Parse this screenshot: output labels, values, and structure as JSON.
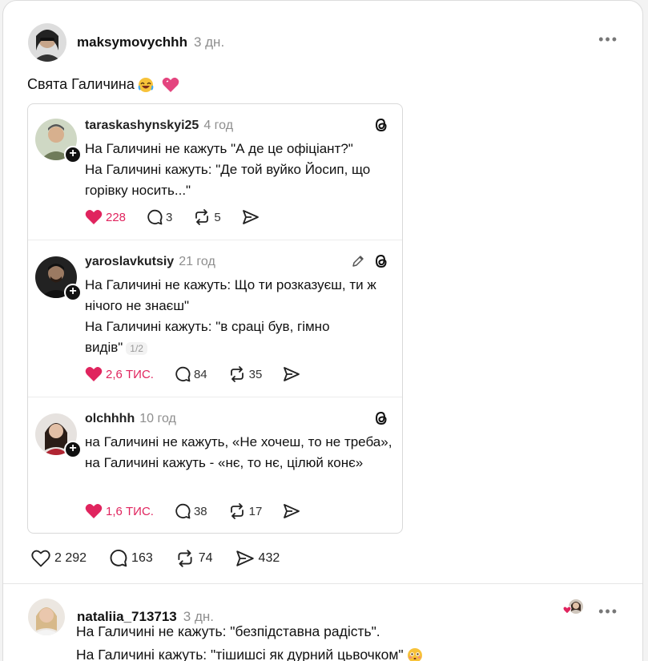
{
  "post": {
    "username": "maksymovychhh",
    "time": "3 дн.",
    "text": "Свята Галичина",
    "stats": {
      "likes": "2 292",
      "replies": "163",
      "reposts": "74",
      "shares": "432"
    }
  },
  "quotes": [
    {
      "username": "taraskashynskyi25",
      "time": "4 год",
      "lines": [
        "На Галичині не кажуть \"А де це офіціант?\"",
        "На Галичині кажуть: \"Де той вуйко Йосип, що горівку носить...\""
      ],
      "likes": "228",
      "replies": "3",
      "reposts": "5"
    },
    {
      "username": "yaroslavkutsiy",
      "time": "21 год",
      "lines": [
        "На Галичині не кажуть: Що ти розказуєш, ти ж нічого не знаєш\"",
        "На Галичині кажуть: \"в сраці був, гімно видів\""
      ],
      "page": "1/2",
      "likes": "2,6 ТИС.",
      "replies": "84",
      "reposts": "35"
    },
    {
      "username": "olchhhh",
      "time": "10 год",
      "lines": [
        "на Галичині не кажуть, «Не хочеш, то не треба»,",
        "на Галичині кажуть - «нє, то нє, цілюй конє»"
      ],
      "likes": "1,6 ТИС.",
      "replies": "38",
      "reposts": "17"
    }
  ],
  "reply": {
    "username": "nataliia_713713",
    "time": "3 дн.",
    "lines": [
      "На Галичині не кажуть: \"безпідставна радість\".",
      "На Галичині кажуть: \"тішишсі як дурний цьвочком\""
    ]
  },
  "colors": {
    "like": "#e0245e",
    "muted": "#8e8e8e"
  },
  "icons": [
    "heart-icon",
    "comment-icon",
    "repost-icon",
    "share-icon",
    "threads-logo-icon",
    "edit-icon",
    "more-icon",
    "plus-icon"
  ]
}
